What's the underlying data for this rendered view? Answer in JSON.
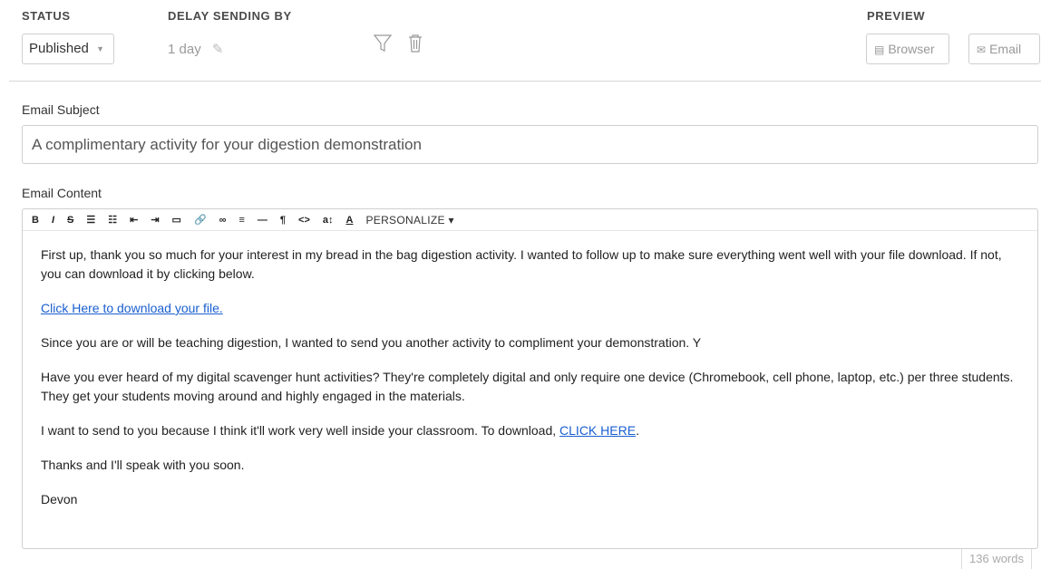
{
  "header": {
    "status_label": "STATUS",
    "delay_label": "DELAY SENDING BY",
    "preview_label": "PREVIEW",
    "status_value": "Published",
    "delay_value": "1 day",
    "browser_btn": "Browser",
    "email_btn": "Email"
  },
  "subject": {
    "label": "Email Subject",
    "value": "A complimentary activity for your digestion demonstration"
  },
  "content": {
    "label": "Email Content",
    "toolbar": {
      "bold": "B",
      "italic": "I",
      "strike": "S",
      "ul": "☰",
      "ol": "☷",
      "outdent": "⇤",
      "indent": "⇥",
      "image": "▭",
      "attach": "🔗",
      "link": "∞",
      "align": "≡",
      "hr": "—",
      "para": "¶",
      "code": "<>",
      "fontsize": "a↕",
      "color": "A",
      "personalize": "PERSONALIZE ▾"
    },
    "p1": "First up, thank you so much for your interest in my bread in the bag digestion activity. I wanted to follow up to make sure everything went well with your file download. If not, you can download it by clicking below.",
    "link1": "Click Here to download your file.",
    "p2": "Since you are or will be teaching digestion, I wanted to send you another activity to compliment your demonstration. Y",
    "p3": "Have you ever heard of my digital scavenger hunt activities? They're completely digital and only require one device (Chromebook, cell phone, laptop, etc.) per three students. They get your students moving around and highly engaged in the materials.",
    "p4_pre": "I want to send to you because I think it'll work very well inside your classroom. To download, ",
    "p4_link": "CLICK HERE",
    "p4_post": ".",
    "p5": "Thanks and I'll speak with you soon.",
    "p6": "Devon"
  },
  "footer": {
    "word_count": "136 words"
  }
}
